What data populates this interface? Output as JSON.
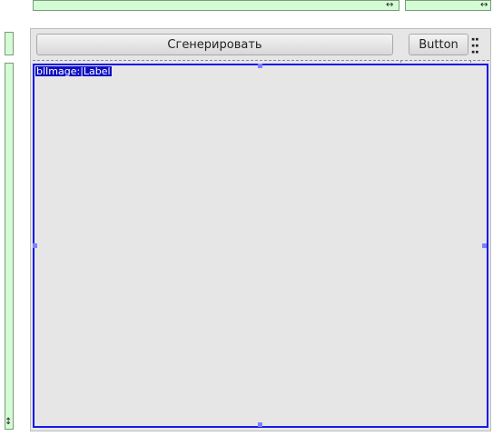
{
  "designer": {
    "generate_button": "Сгенерировать",
    "button": "Button",
    "image_label": "blImage:|Label",
    "h_arrow": "↔",
    "v_arrow": "↕"
  }
}
